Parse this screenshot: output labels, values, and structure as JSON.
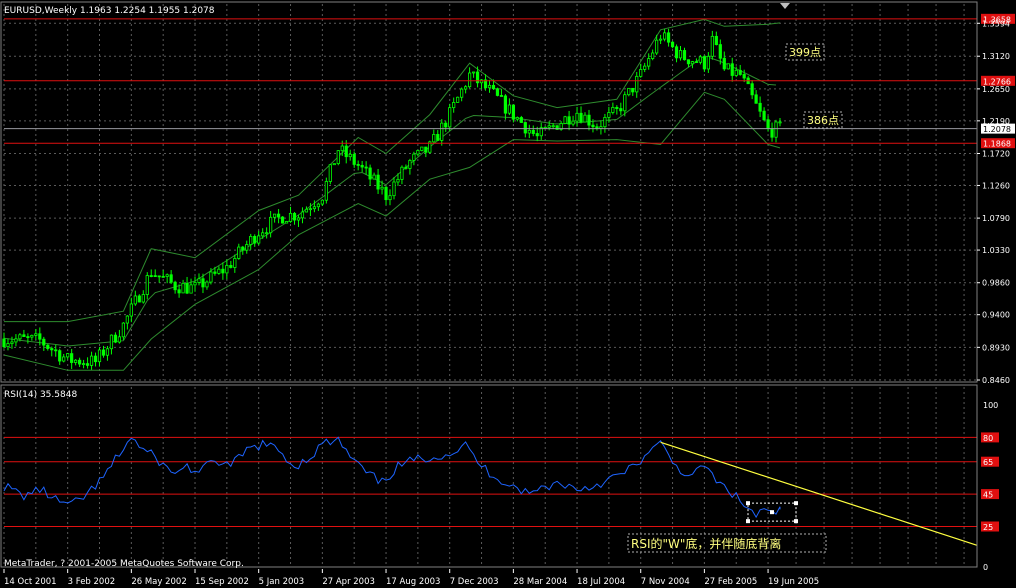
{
  "window": {
    "header": "EURUSD,Weekly  1.1963 1.2254 1.1955 1.2078",
    "rsi_header": "RSI(14) 35.5848",
    "copyright": "MetaTrader, ? 2001-2005 MetaQuotes Software Corp."
  },
  "colors": {
    "background": "#000000",
    "grid": "#5a5a5a",
    "candle": "#00ff00",
    "bollinger": "#2e8b2e",
    "level_line": "#e01010",
    "rsi_line": "#1e64ff",
    "trendline": "#ffff40",
    "annotation_text": "#ffff80",
    "axis_text": "#ffffff"
  },
  "chart_data": [
    {
      "type": "candlestick",
      "title": "EURUSD,Weekly",
      "ohlc_last": {
        "open": 1.1963,
        "high": 1.2254,
        "low": 1.1955,
        "close": 1.2078
      },
      "overlay": "Bollinger Bands",
      "y_ticks": [
        1.3594,
        1.312,
        1.265,
        1.219,
        1.172,
        1.126,
        1.079,
        1.033,
        0.986,
        0.94,
        0.893,
        0.846
      ],
      "ylim": [
        0.846,
        1.367
      ],
      "current_price": 1.2078,
      "price_marker_labels": [
        {
          "label": "1.3658",
          "value": 1.3658
        },
        {
          "label": "1.2766",
          "value": 1.2766
        },
        {
          "label": "1.1868",
          "value": 1.1868
        }
      ],
      "x_tick_labels": [
        "14 Oct 2001",
        "3 Feb 2002",
        "26 May 2002",
        "15 Sep 2002",
        "5 Jan 2003",
        "27 Apr 2003",
        "17 Aug 2003",
        "7 Dec 2003",
        "28 Mar 2004",
        "18 Jul 2004",
        "7 Nov 2004",
        "27 Feb 2005",
        "19 Jun 2005"
      ],
      "annotations": [
        {
          "text": "399点",
          "from": 1.3658,
          "to": 1.2766
        },
        {
          "text": "386点",
          "from": 1.2766,
          "to": 1.1868
        }
      ],
      "close_path": [
        [
          "2001-10-14",
          0.905
        ],
        [
          "2001-12-16",
          0.903
        ],
        [
          "2002-02-03",
          0.875
        ],
        [
          "2002-03-24",
          0.872
        ],
        [
          "2002-05-12",
          0.925
        ],
        [
          "2002-06-30",
          1.002
        ],
        [
          "2002-08-11",
          0.982
        ],
        [
          "2002-09-15",
          0.978
        ],
        [
          "2002-11-10",
          1.008
        ],
        [
          "2003-01-05",
          1.06
        ],
        [
          "2003-02-16",
          1.082
        ],
        [
          "2003-03-16",
          1.085
        ],
        [
          "2003-04-27",
          1.112
        ],
        [
          "2003-05-25",
          1.178
        ],
        [
          "2003-06-29",
          1.155
        ],
        [
          "2003-08-17",
          1.112
        ],
        [
          "2003-09-28",
          1.16
        ],
        [
          "2003-11-02",
          1.18
        ],
        [
          "2003-12-07",
          1.228
        ],
        [
          "2004-01-11",
          1.285
        ],
        [
          "2004-02-15",
          1.262
        ],
        [
          "2004-03-28",
          1.228
        ],
        [
          "2004-05-09",
          1.195
        ],
        [
          "2004-06-13",
          1.215
        ],
        [
          "2004-07-18",
          1.232
        ],
        [
          "2004-08-22",
          1.212
        ],
        [
          "2004-09-26",
          1.232
        ],
        [
          "2004-11-07",
          1.285
        ],
        [
          "2004-12-12",
          1.342
        ],
        [
          "2005-01-16",
          1.312
        ],
        [
          "2005-02-27",
          1.302
        ],
        [
          "2005-03-13",
          1.335
        ],
        [
          "2005-04-03",
          1.292
        ],
        [
          "2005-05-01",
          1.285
        ],
        [
          "2005-05-29",
          1.24
        ],
        [
          "2005-06-19",
          1.205
        ],
        [
          "2005-07-10",
          1.2078
        ]
      ],
      "bollinger_upper": [
        [
          "2001-10-14",
          0.93
        ],
        [
          "2002-02-03",
          0.93
        ],
        [
          "2002-05-12",
          0.945
        ],
        [
          "2002-06-30",
          1.035
        ],
        [
          "2002-09-15",
          1.022
        ],
        [
          "2003-01-05",
          1.09
        ],
        [
          "2003-03-16",
          1.112
        ],
        [
          "2003-06-29",
          1.195
        ],
        [
          "2003-08-17",
          1.172
        ],
        [
          "2003-11-02",
          1.228
        ],
        [
          "2004-01-11",
          1.302
        ],
        [
          "2004-03-28",
          1.255
        ],
        [
          "2004-06-13",
          1.238
        ],
        [
          "2004-09-26",
          1.25
        ],
        [
          "2004-12-12",
          1.35
        ],
        [
          "2005-02-27",
          1.365
        ],
        [
          "2005-04-03",
          1.355
        ],
        [
          "2005-06-19",
          1.358
        ],
        [
          "2005-07-10",
          1.36
        ]
      ],
      "bollinger_lower": [
        [
          "2001-10-14",
          0.882
        ],
        [
          "2002-02-03",
          0.86
        ],
        [
          "2002-05-12",
          0.86
        ],
        [
          "2002-06-30",
          0.905
        ],
        [
          "2002-09-15",
          0.955
        ],
        [
          "2003-01-05",
          1.005
        ],
        [
          "2003-03-16",
          1.055
        ],
        [
          "2003-06-29",
          1.1
        ],
        [
          "2003-08-17",
          1.082
        ],
        [
          "2003-11-02",
          1.135
        ],
        [
          "2004-01-11",
          1.152
        ],
        [
          "2004-03-28",
          1.192
        ],
        [
          "2004-06-13",
          1.19
        ],
        [
          "2004-09-26",
          1.192
        ],
        [
          "2004-12-12",
          1.185
        ],
        [
          "2005-02-27",
          1.26
        ],
        [
          "2005-04-03",
          1.25
        ],
        [
          "2005-06-19",
          1.185
        ],
        [
          "2005-07-10",
          1.18
        ]
      ]
    },
    {
      "type": "line",
      "title": "RSI(14) 35.5848",
      "ylim": [
        0,
        100
      ],
      "y_ticks": [
        0,
        100
      ],
      "level_labels": [
        {
          "label": "80",
          "value": 80
        },
        {
          "label": "65",
          "value": 65
        },
        {
          "label": "45",
          "value": 45
        },
        {
          "label": "25",
          "value": 25
        }
      ],
      "series": [
        {
          "points": [
            [
              "2001-10-14",
              50
            ],
            [
              "2001-11-18",
              44
            ],
            [
              "2001-12-16",
              48
            ],
            [
              "2002-01-20",
              40
            ],
            [
              "2002-02-10",
              38
            ],
            [
              "2002-03-10",
              45
            ],
            [
              "2002-04-07",
              55
            ],
            [
              "2002-05-05",
              70
            ],
            [
              "2002-05-26",
              80
            ],
            [
              "2002-06-16",
              72
            ],
            [
              "2002-07-07",
              68
            ],
            [
              "2002-08-04",
              58
            ],
            [
              "2002-09-01",
              62
            ],
            [
              "2002-09-22",
              58
            ],
            [
              "2002-10-20",
              66
            ],
            [
              "2002-11-17",
              62
            ],
            [
              "2002-12-15",
              72
            ],
            [
              "2003-01-12",
              76
            ],
            [
              "2003-02-09",
              72
            ],
            [
              "2003-03-09",
              62
            ],
            [
              "2003-04-06",
              68
            ],
            [
              "2003-04-27",
              76
            ],
            [
              "2003-05-25",
              78
            ],
            [
              "2003-06-15",
              68
            ],
            [
              "2003-07-13",
              58
            ],
            [
              "2003-08-10",
              52
            ],
            [
              "2003-09-07",
              62
            ],
            [
              "2003-10-05",
              66
            ],
            [
              "2003-11-02",
              68
            ],
            [
              "2003-12-07",
              70
            ],
            [
              "2004-01-04",
              75
            ],
            [
              "2004-02-01",
              62
            ],
            [
              "2004-02-29",
              55
            ],
            [
              "2004-03-28",
              50
            ],
            [
              "2004-04-25",
              45
            ],
            [
              "2004-05-23",
              50
            ],
            [
              "2004-06-20",
              52
            ],
            [
              "2004-07-18",
              48
            ],
            [
              "2004-08-15",
              50
            ],
            [
              "2004-09-12",
              54
            ],
            [
              "2004-10-10",
              58
            ],
            [
              "2004-11-07",
              66
            ],
            [
              "2004-12-12",
              76
            ],
            [
              "2005-01-09",
              62
            ],
            [
              "2005-02-06",
              55
            ],
            [
              "2005-02-27",
              64
            ],
            [
              "2005-03-20",
              52
            ],
            [
              "2005-04-10",
              48
            ],
            [
              "2005-05-08",
              38
            ],
            [
              "2005-05-29",
              32
            ],
            [
              "2005-06-12",
              35
            ],
            [
              "2005-06-26",
              32
            ],
            [
              "2005-07-10",
              35.5848
            ]
          ]
        }
      ],
      "trendline": [
        [
          "2004-12-12",
          77
        ],
        [
          "2005-07-10",
          53
        ]
      ],
      "annotation": "RSI的\"W\"底，并伴随底背离"
    }
  ]
}
